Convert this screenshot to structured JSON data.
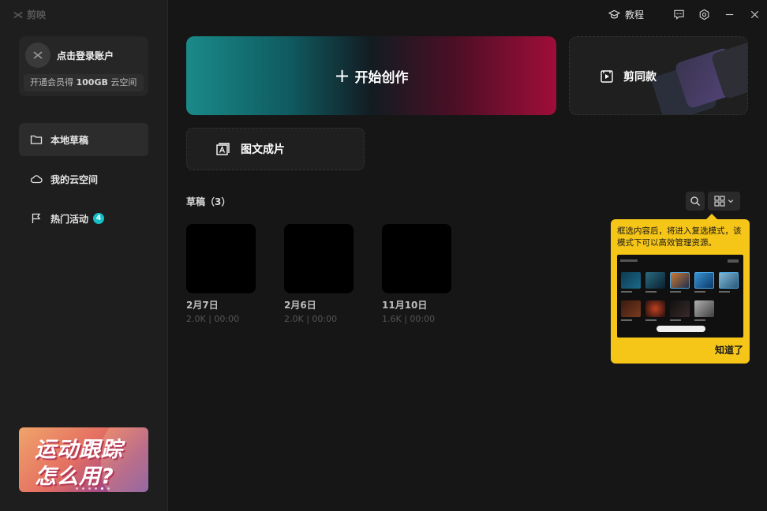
{
  "app": {
    "name": "剪映"
  },
  "titlebar": {
    "tutorial_label": "教程"
  },
  "account": {
    "login_label": "点击登录账户",
    "vip_prefix": "开通会员得 ",
    "vip_amount": "100GB",
    "vip_suffix": " 云空间"
  },
  "sidebar": {
    "items": [
      {
        "label": "本地草稿",
        "icon": "folder-icon",
        "active": true
      },
      {
        "label": "我的云空间",
        "icon": "cloud-icon",
        "active": false
      },
      {
        "label": "热门活动",
        "icon": "flag-icon",
        "active": false,
        "badge": "4"
      }
    ]
  },
  "promo": {
    "line1": "运动跟踪",
    "line2": "怎么用?"
  },
  "main": {
    "start_label": "开始创作",
    "template_label": "剪同款",
    "imgtext_label": "图文成片",
    "drafts_title": "草稿（3）"
  },
  "drafts": [
    {
      "title": "2月7日",
      "meta": "2.0K | 00:00"
    },
    {
      "title": "2月6日",
      "meta": "2.0K | 00:00"
    },
    {
      "title": "11月10日",
      "meta": "1.6K | 00:00"
    }
  ],
  "tooltip": {
    "text": "框选内容后，将进入复选模式，该模式下可以高效管理资源。",
    "ok_label": "知道了"
  },
  "colors": {
    "accent": "#16c1c6",
    "tooltip_bg": "#f5c518",
    "background": "#161616"
  }
}
